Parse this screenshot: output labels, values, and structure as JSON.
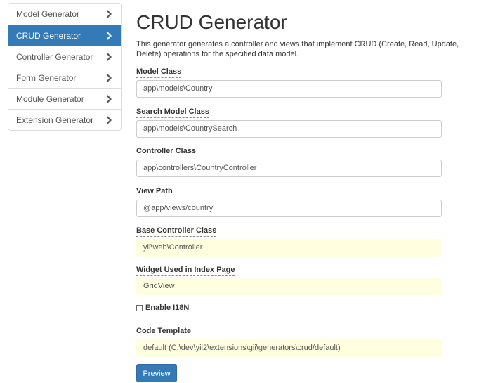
{
  "sidebar": {
    "items": [
      {
        "label": "Model Generator",
        "active": false
      },
      {
        "label": "CRUD Generator",
        "active": true
      },
      {
        "label": "Controller Generator",
        "active": false
      },
      {
        "label": "Form Generator",
        "active": false
      },
      {
        "label": "Module Generator",
        "active": false
      },
      {
        "label": "Extension Generator",
        "active": false
      }
    ]
  },
  "page": {
    "title": "CRUD Generator",
    "description": "This generator generates a controller and views that implement CRUD (Create, Read, Update, Delete) operations for the specified data model."
  },
  "form": {
    "model_class": {
      "label": "Model Class",
      "value": "app\\models\\Country"
    },
    "search_model_class": {
      "label": "Search Model Class",
      "value": "app\\models\\CountrySearch"
    },
    "controller_class": {
      "label": "Controller Class",
      "value": "app\\controllers\\CountryController"
    },
    "view_path": {
      "label": "View Path",
      "value": "@app/views/country"
    },
    "base_controller_class": {
      "label": "Base Controller Class",
      "value": "yii\\web\\Controller"
    },
    "widget_index": {
      "label": "Widget Used in Index Page",
      "value": "GridView"
    },
    "enable_i18n": {
      "label": "Enable I18N",
      "checked": false
    },
    "code_template": {
      "label": "Code Template",
      "value": "default (C:\\dev\\yii2\\extensions\\gii\\generators\\crud/default)"
    },
    "preview_label": "Preview"
  },
  "colors": {
    "accent": "#337ab7",
    "sticky_field_bg": "#ffffe0"
  },
  "icons": {
    "sidebar_item": "chevron-right-icon",
    "checkbox": "checkbox-unchecked-icon"
  }
}
